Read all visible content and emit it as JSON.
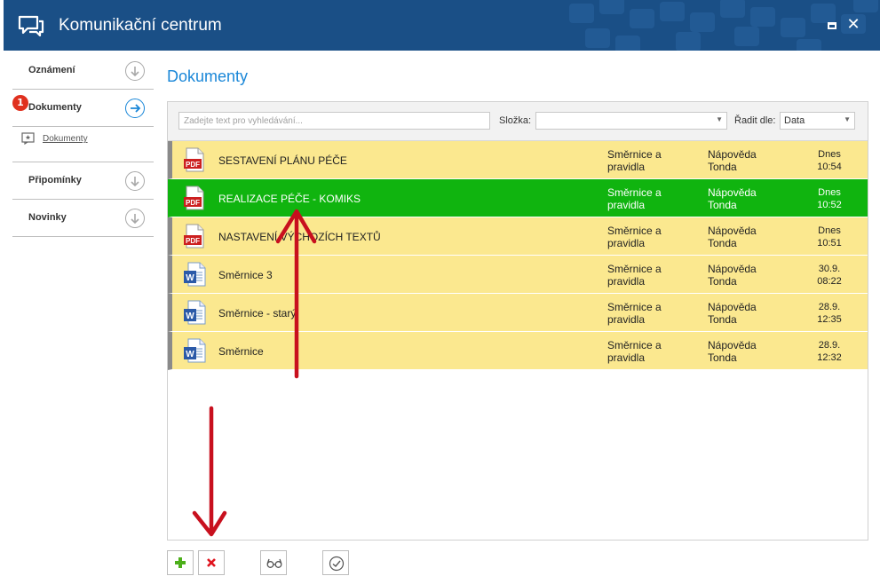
{
  "window": {
    "title": "Komunikační centrum"
  },
  "nav": {
    "items": [
      {
        "label": "Oznámení"
      },
      {
        "label": "Dokumenty",
        "badge": "1"
      },
      {
        "label": "Připomínky"
      },
      {
        "label": "Novinky"
      }
    ],
    "sub_item": {
      "label": "Dokumenty"
    }
  },
  "main": {
    "heading": "Dokumenty",
    "search": {
      "placeholder": "Zadejte text pro vyhledávání...",
      "value": ""
    },
    "folder_label": "Složka:",
    "folder_value": "",
    "sort_label": "Řadit dle:",
    "sort_value": "Data"
  },
  "documents": [
    {
      "name": "SESTAVENÍ PLÁNU PÉČE",
      "type": "pdf",
      "folder": "Směrnice a pravidla",
      "author": "Nápověda Tonda",
      "date": "Dnes",
      "time": "10:54",
      "selected": false
    },
    {
      "name": "REALIZACE PÉČE - KOMIKS",
      "type": "pdf",
      "folder": "Směrnice a pravidla",
      "author": "Nápověda Tonda",
      "date": "Dnes",
      "time": "10:52",
      "selected": true
    },
    {
      "name": "NASTAVENÍ VÝCHOZÍCH TEXTŮ",
      "type": "pdf",
      "folder": "Směrnice a pravidla",
      "author": "Nápověda Tonda",
      "date": "Dnes",
      "time": "10:51",
      "selected": false
    },
    {
      "name": "Směrnice 3",
      "type": "word",
      "folder": "Směrnice a pravidla",
      "author": "Nápověda Tonda",
      "date": "30.9.",
      "time": "08:22",
      "selected": false
    },
    {
      "name": "Směrnice - starý",
      "type": "word",
      "folder": "Směrnice a pravidla",
      "author": "Nápověda Tonda",
      "date": "28.9.",
      "time": "12:35",
      "selected": false
    },
    {
      "name": "Směrnice",
      "type": "word",
      "folder": "Směrnice a pravidla",
      "author": "Nápověda Tonda",
      "date": "28.9.",
      "time": "12:32",
      "selected": false
    }
  ],
  "icons": {
    "pdf": "pdf-file-icon",
    "word": "word-file-icon",
    "pdf_text": "PDF",
    "word_text": "W"
  },
  "colors": {
    "titlebar": "#1a4f86",
    "accent": "#1a87d8",
    "row": "#fbe88f",
    "selected": "#10b40f",
    "annotation": "#c8101e"
  }
}
